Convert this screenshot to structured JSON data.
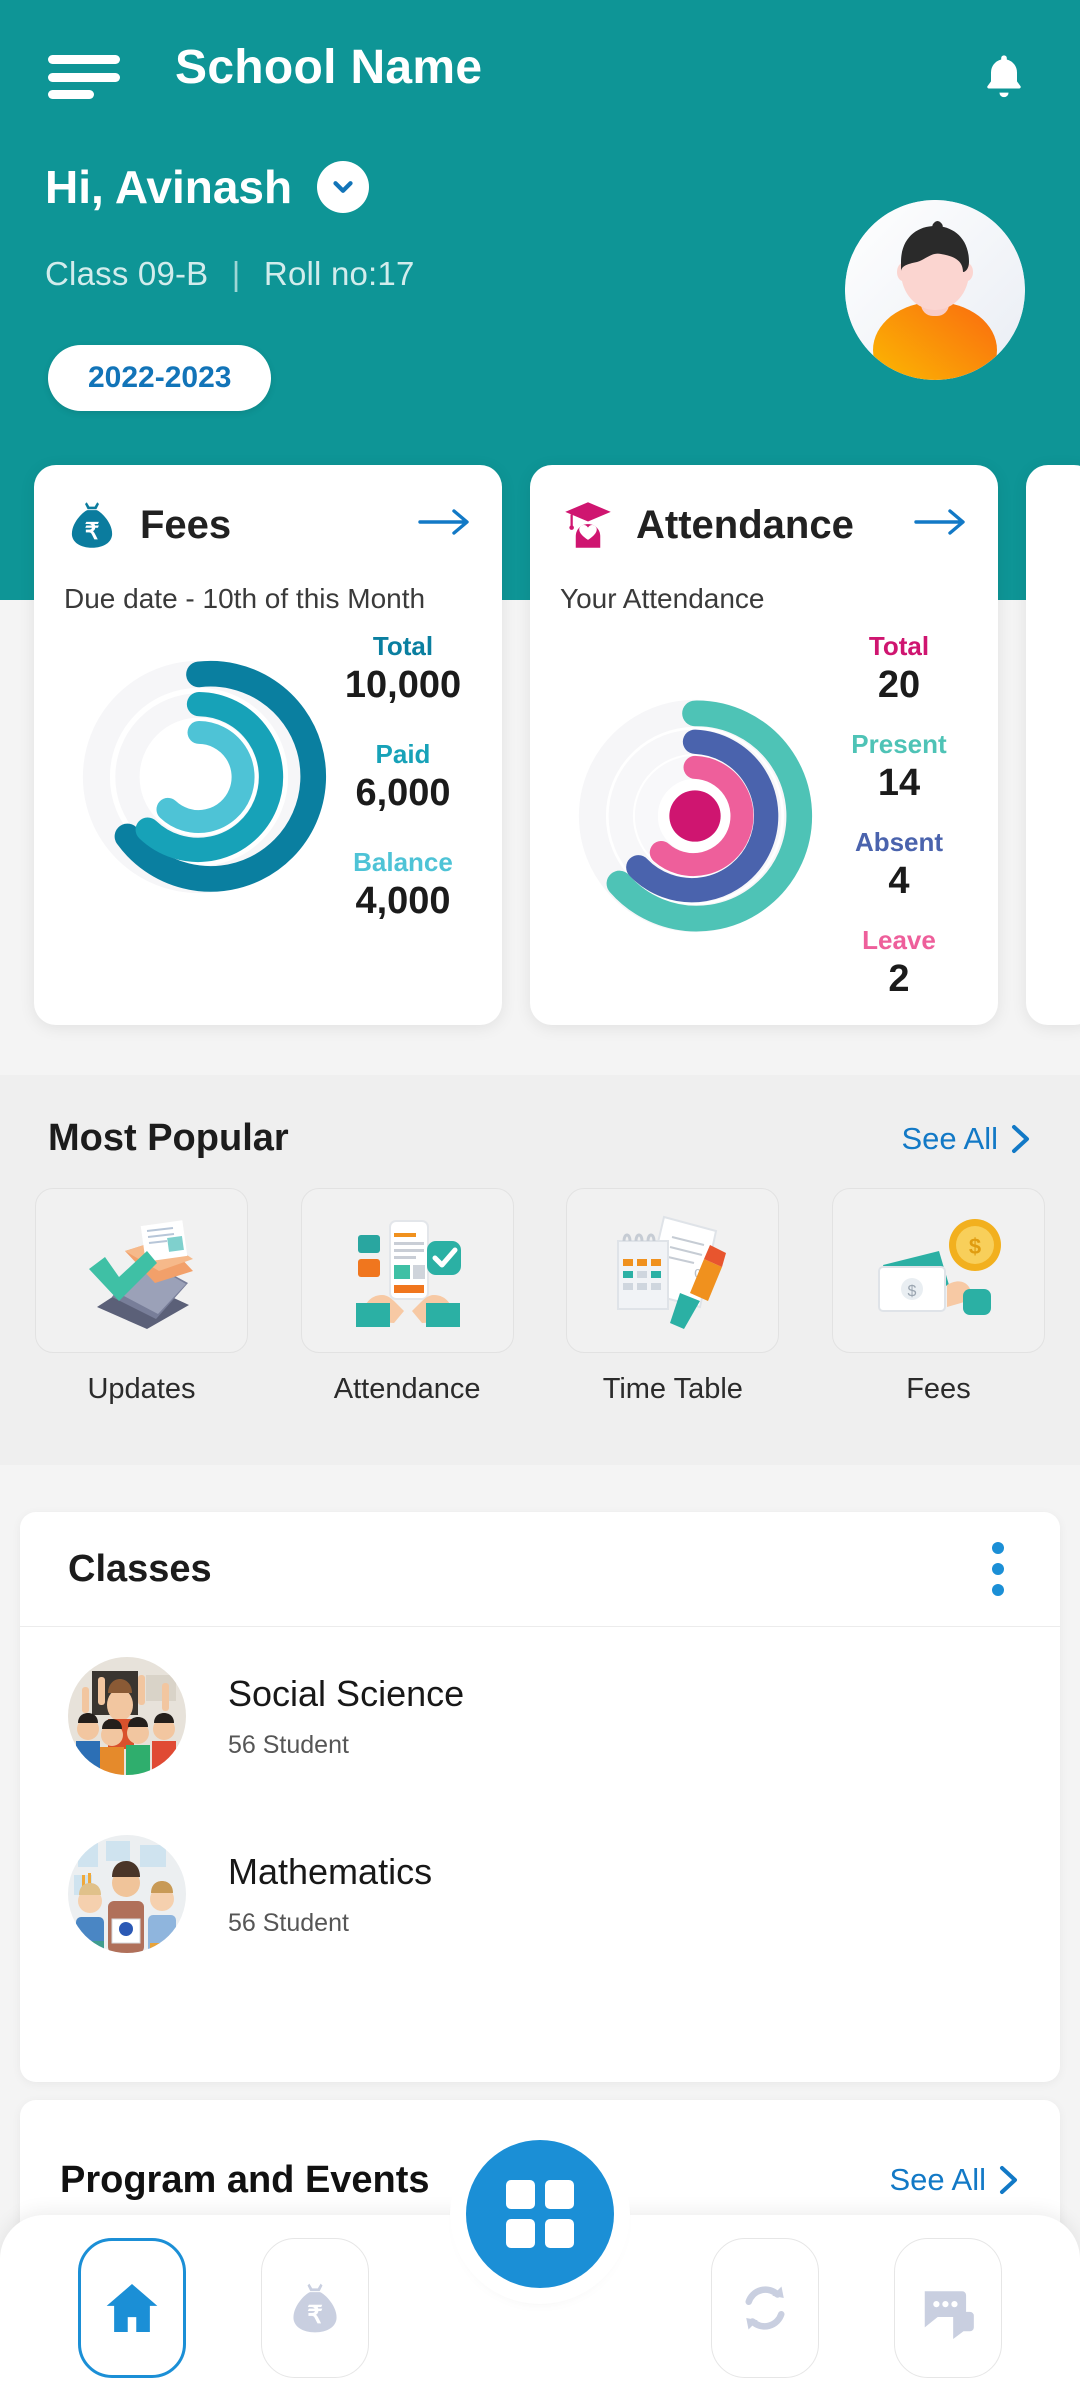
{
  "header": {
    "school_name": "School Name",
    "greeting": "Hi, Avinash",
    "class_label": "Class 09-B",
    "separator": "|",
    "roll_label": "Roll no:17",
    "year": "2022-2023",
    "menu_icon": "hamburger-icon",
    "bell_icon": "bell-icon",
    "chevron_icon": "chevron-down-icon",
    "avatar_icon": "student-avatar",
    "bg_color": "#0e9596",
    "year_text_color": "#1274b8"
  },
  "cards": [
    {
      "id": "fees",
      "title": "Fees",
      "icon": "money-bag-icon",
      "icon_color": "#0b7c9e",
      "subtitle": "Due date - 10th of this Month",
      "arrow_icon": "arrow-right-icon",
      "stats": [
        {
          "label": "Total",
          "value": "10,000",
          "color": "#0a7fa0"
        },
        {
          "label": "Paid",
          "value": "6,000",
          "color": "#17a2b8"
        },
        {
          "label": "Balance",
          "value": "4,000",
          "color": "#4ec3d6"
        }
      ]
    },
    {
      "id": "attendance",
      "title": "Attendance",
      "icon": "graduate-cap-icon",
      "icon_color": "#cf1570",
      "subtitle": "Your Attendance",
      "arrow_icon": "arrow-right-icon",
      "stats": [
        {
          "label": "Total",
          "value": "20",
          "color": "#cf1570"
        },
        {
          "label": "Present",
          "value": "14",
          "color": "#4ec3b6"
        },
        {
          "label": "Absent",
          "value": "4",
          "color": "#4a63ad"
        },
        {
          "label": "Leave",
          "value": "2",
          "color": "#ee5f9b"
        }
      ]
    }
  ],
  "chart_data": [
    {
      "type": "pie",
      "title": "Fees",
      "categories": [
        "Total",
        "Paid",
        "Balance"
      ],
      "values": [
        10000,
        6000,
        4000
      ],
      "colors": [
        "#0a7fa0",
        "#17a2b8",
        "#4ec3d6"
      ],
      "style": "concentric-arc-donut",
      "arc_fractions": [
        0.8,
        0.72,
        0.62
      ],
      "legend": "right"
    },
    {
      "type": "pie",
      "title": "Your Attendance",
      "categories": [
        "Total",
        "Present",
        "Absent",
        "Leave"
      ],
      "values": [
        20,
        14,
        4,
        2
      ],
      "colors": [
        "#4ec3b6",
        "#4a63ad",
        "#ee5f9b",
        "#cf1570"
      ],
      "style": "concentric-arc-donut",
      "arc_fractions": [
        0.82,
        0.74,
        0.66,
        1.0
      ],
      "legend": "right"
    }
  ],
  "popular": {
    "title": "Most Popular",
    "see_all": "See All",
    "chevron_icon": "chevron-right-icon",
    "items": [
      {
        "label": "Updates",
        "icon": "laptop-envelope-icon"
      },
      {
        "label": "Attendance",
        "icon": "hands-phone-check-icon"
      },
      {
        "label": "Time Table",
        "icon": "calendar-pencil-icon"
      },
      {
        "label": "Fees",
        "icon": "cash-coin-icon"
      }
    ]
  },
  "classes": {
    "title": "Classes",
    "menu_icon": "kebab-menu-icon",
    "items": [
      {
        "name": "Social Science",
        "students": "56 Student",
        "thumb": "classroom-kids-photo"
      },
      {
        "name": "Mathematics",
        "students": "56 Student",
        "thumb": "teacher-students-photo"
      }
    ]
  },
  "program": {
    "title": "Program and Events",
    "see_all": "See All",
    "chevron_icon": "chevron-right-icon"
  },
  "nav": {
    "items": [
      {
        "id": "home",
        "icon": "home-icon",
        "active": true
      },
      {
        "id": "fees",
        "icon": "money-bag-icon",
        "active": false
      },
      {
        "id": "sync",
        "icon": "refresh-icon",
        "active": false
      },
      {
        "id": "chat",
        "icon": "chat-bubble-icon",
        "active": false
      }
    ],
    "fab_icon": "grid-apps-icon",
    "active_color": "#1b8fd6",
    "inactive_color": "#c9cfe0"
  }
}
